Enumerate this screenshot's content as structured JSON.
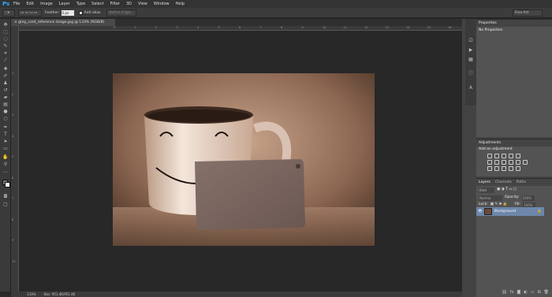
{
  "app": {
    "logo": "Ps"
  },
  "menu": [
    "File",
    "Edit",
    "Image",
    "Layer",
    "Type",
    "Select",
    "Filter",
    "3D",
    "View",
    "Window",
    "Help"
  ],
  "options": {
    "feather_label": "Feather:",
    "feather_value": "0 px",
    "antialias_label": "Anti-alias",
    "refine_label": "Refine Edge...",
    "workspace": "Fine Art"
  },
  "document": {
    "tab_title": "grey_card_reference image.jpg @ 133% (RGB/8)",
    "close": "×"
  },
  "rulers": {
    "h": [
      "0",
      "1",
      "2",
      "3",
      "4",
      "5",
      "6",
      "7",
      "8",
      "9",
      "10",
      "11",
      "12",
      "13",
      "14",
      "15",
      "16",
      "17",
      "18",
      "19",
      "20"
    ],
    "v": [
      "1",
      "2",
      "3",
      "4",
      "5",
      "6",
      "7",
      "8",
      "9",
      "10"
    ]
  },
  "status": {
    "zoom": "133%",
    "doc": "Doc: 951.4K/951.4K"
  },
  "panels": {
    "properties": {
      "title": "Properties",
      "subtitle": "No Properties"
    },
    "adjustments": {
      "title": "Adjustments",
      "subtitle": "Add an adjustment"
    },
    "layers": {
      "tabs": [
        "Layers",
        "Channels",
        "Paths"
      ],
      "kind": "Kind",
      "mode": "Normal",
      "opacity_label": "Opacity:",
      "opacity_value": "100%",
      "lock_label": "Lock:",
      "fill_label": "Fill:",
      "fill_value": "100%",
      "layer_name": "Background"
    }
  },
  "colors": {
    "accent": "#31a8ff",
    "layer_selected": "#6d87ab",
    "canvas_bg": "#282828"
  }
}
